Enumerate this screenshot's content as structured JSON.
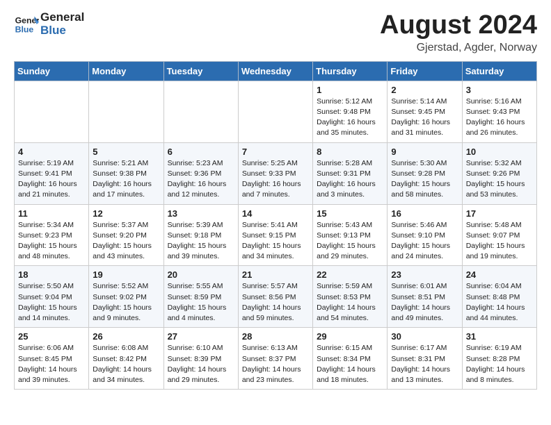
{
  "logo": {
    "line1": "General",
    "line2": "Blue"
  },
  "title": "August 2024",
  "subtitle": "Gjerstad, Agder, Norway",
  "weekdays": [
    "Sunday",
    "Monday",
    "Tuesday",
    "Wednesday",
    "Thursday",
    "Friday",
    "Saturday"
  ],
  "weeks": [
    [
      {
        "day": "",
        "info": ""
      },
      {
        "day": "",
        "info": ""
      },
      {
        "day": "",
        "info": ""
      },
      {
        "day": "",
        "info": ""
      },
      {
        "day": "1",
        "info": "Sunrise: 5:12 AM\nSunset: 9:48 PM\nDaylight: 16 hours\nand 35 minutes."
      },
      {
        "day": "2",
        "info": "Sunrise: 5:14 AM\nSunset: 9:45 PM\nDaylight: 16 hours\nand 31 minutes."
      },
      {
        "day": "3",
        "info": "Sunrise: 5:16 AM\nSunset: 9:43 PM\nDaylight: 16 hours\nand 26 minutes."
      }
    ],
    [
      {
        "day": "4",
        "info": "Sunrise: 5:19 AM\nSunset: 9:41 PM\nDaylight: 16 hours\nand 21 minutes."
      },
      {
        "day": "5",
        "info": "Sunrise: 5:21 AM\nSunset: 9:38 PM\nDaylight: 16 hours\nand 17 minutes."
      },
      {
        "day": "6",
        "info": "Sunrise: 5:23 AM\nSunset: 9:36 PM\nDaylight: 16 hours\nand 12 minutes."
      },
      {
        "day": "7",
        "info": "Sunrise: 5:25 AM\nSunset: 9:33 PM\nDaylight: 16 hours\nand 7 minutes."
      },
      {
        "day": "8",
        "info": "Sunrise: 5:28 AM\nSunset: 9:31 PM\nDaylight: 16 hours\nand 3 minutes."
      },
      {
        "day": "9",
        "info": "Sunrise: 5:30 AM\nSunset: 9:28 PM\nDaylight: 15 hours\nand 58 minutes."
      },
      {
        "day": "10",
        "info": "Sunrise: 5:32 AM\nSunset: 9:26 PM\nDaylight: 15 hours\nand 53 minutes."
      }
    ],
    [
      {
        "day": "11",
        "info": "Sunrise: 5:34 AM\nSunset: 9:23 PM\nDaylight: 15 hours\nand 48 minutes."
      },
      {
        "day": "12",
        "info": "Sunrise: 5:37 AM\nSunset: 9:20 PM\nDaylight: 15 hours\nand 43 minutes."
      },
      {
        "day": "13",
        "info": "Sunrise: 5:39 AM\nSunset: 9:18 PM\nDaylight: 15 hours\nand 39 minutes."
      },
      {
        "day": "14",
        "info": "Sunrise: 5:41 AM\nSunset: 9:15 PM\nDaylight: 15 hours\nand 34 minutes."
      },
      {
        "day": "15",
        "info": "Sunrise: 5:43 AM\nSunset: 9:13 PM\nDaylight: 15 hours\nand 29 minutes."
      },
      {
        "day": "16",
        "info": "Sunrise: 5:46 AM\nSunset: 9:10 PM\nDaylight: 15 hours\nand 24 minutes."
      },
      {
        "day": "17",
        "info": "Sunrise: 5:48 AM\nSunset: 9:07 PM\nDaylight: 15 hours\nand 19 minutes."
      }
    ],
    [
      {
        "day": "18",
        "info": "Sunrise: 5:50 AM\nSunset: 9:04 PM\nDaylight: 15 hours\nand 14 minutes."
      },
      {
        "day": "19",
        "info": "Sunrise: 5:52 AM\nSunset: 9:02 PM\nDaylight: 15 hours\nand 9 minutes."
      },
      {
        "day": "20",
        "info": "Sunrise: 5:55 AM\nSunset: 8:59 PM\nDaylight: 15 hours\nand 4 minutes."
      },
      {
        "day": "21",
        "info": "Sunrise: 5:57 AM\nSunset: 8:56 PM\nDaylight: 14 hours\nand 59 minutes."
      },
      {
        "day": "22",
        "info": "Sunrise: 5:59 AM\nSunset: 8:53 PM\nDaylight: 14 hours\nand 54 minutes."
      },
      {
        "day": "23",
        "info": "Sunrise: 6:01 AM\nSunset: 8:51 PM\nDaylight: 14 hours\nand 49 minutes."
      },
      {
        "day": "24",
        "info": "Sunrise: 6:04 AM\nSunset: 8:48 PM\nDaylight: 14 hours\nand 44 minutes."
      }
    ],
    [
      {
        "day": "25",
        "info": "Sunrise: 6:06 AM\nSunset: 8:45 PM\nDaylight: 14 hours\nand 39 minutes."
      },
      {
        "day": "26",
        "info": "Sunrise: 6:08 AM\nSunset: 8:42 PM\nDaylight: 14 hours\nand 34 minutes."
      },
      {
        "day": "27",
        "info": "Sunrise: 6:10 AM\nSunset: 8:39 PM\nDaylight: 14 hours\nand 29 minutes."
      },
      {
        "day": "28",
        "info": "Sunrise: 6:13 AM\nSunset: 8:37 PM\nDaylight: 14 hours\nand 23 minutes."
      },
      {
        "day": "29",
        "info": "Sunrise: 6:15 AM\nSunset: 8:34 PM\nDaylight: 14 hours\nand 18 minutes."
      },
      {
        "day": "30",
        "info": "Sunrise: 6:17 AM\nSunset: 8:31 PM\nDaylight: 14 hours\nand 13 minutes."
      },
      {
        "day": "31",
        "info": "Sunrise: 6:19 AM\nSunset: 8:28 PM\nDaylight: 14 hours\nand 8 minutes."
      }
    ]
  ]
}
